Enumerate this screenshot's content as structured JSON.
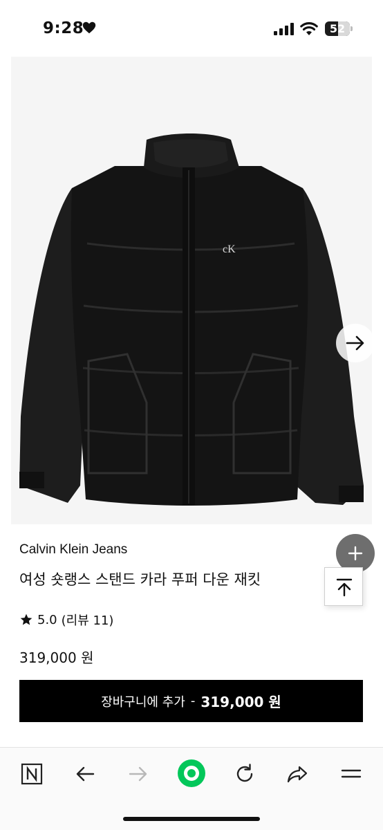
{
  "status": {
    "time": "9:28",
    "battery": "52"
  },
  "product": {
    "brand": "Calvin Klein Jeans",
    "title": "여성 숏랭스 스탠드 카라 푸퍼 다운 재킷",
    "rating": "5.0",
    "reviews": "(리뷰 11)",
    "price": "319,000 원",
    "logo_text": "cK"
  },
  "cart": {
    "label": "장바구니에 추가",
    "separator": "-",
    "amount": "319,000 원"
  },
  "icons": {
    "heart": "heart-icon",
    "next": "arrow-right-icon",
    "zoom": "plus-icon",
    "scroll_top": "arrow-up-to-line-icon",
    "star": "star-icon"
  },
  "toolbar": {
    "logo": "N",
    "items": [
      "naver-logo",
      "back",
      "forward",
      "green-dot",
      "refresh",
      "share",
      "menu"
    ]
  },
  "colors": {
    "accent_green": "#03c75a",
    "button_black": "#000000",
    "zoom_gray": "#6e6e6e"
  }
}
